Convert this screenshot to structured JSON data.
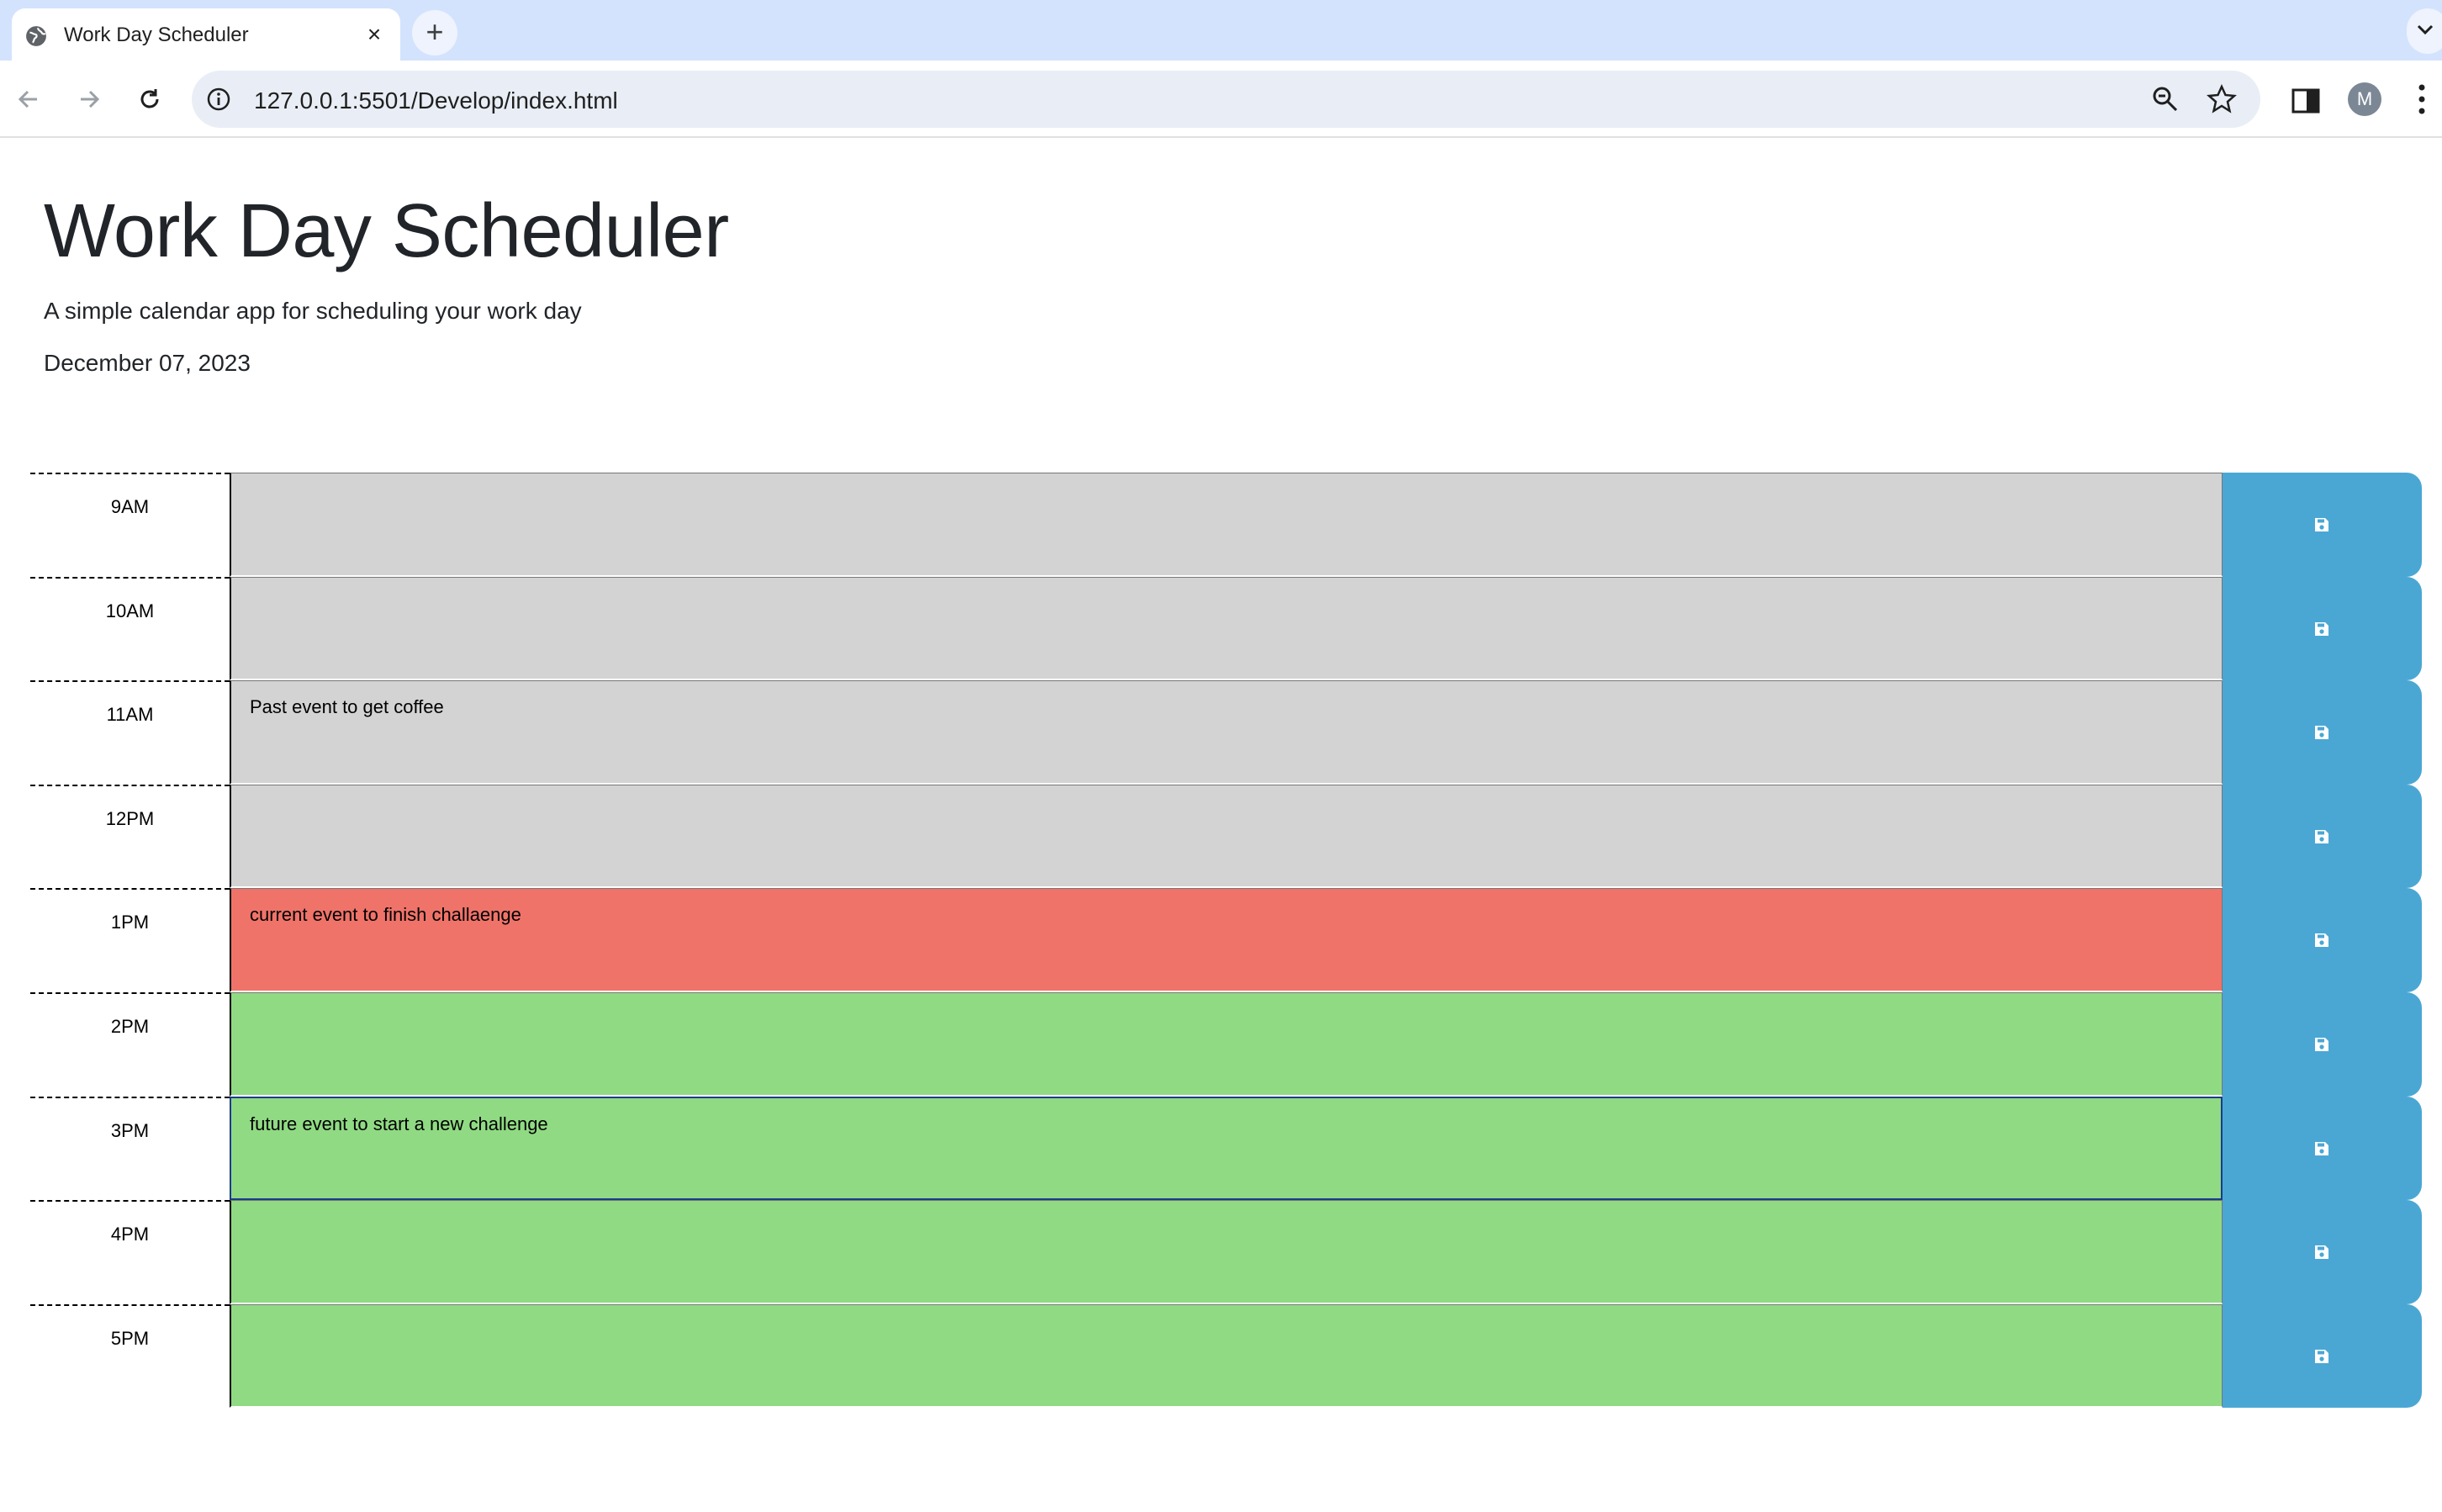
{
  "browser": {
    "tab_title": "Work Day Scheduler",
    "new_tab_symbol": "+",
    "close_symbol": "×",
    "url": "127.0.0.1:5501/Develop/index.html",
    "avatar_initial": "M"
  },
  "header": {
    "title": "Work Day Scheduler",
    "lead": "A simple calendar app for scheduling your work day",
    "current_day": "December 07, 2023"
  },
  "colors": {
    "past": "#d3d3d3",
    "present": "#ef7369",
    "future": "#90da83",
    "save_button": "#4aa7d4"
  },
  "schedule": {
    "rows": [
      {
        "hour": "9AM",
        "text": "",
        "state": "past"
      },
      {
        "hour": "10AM",
        "text": "",
        "state": "past"
      },
      {
        "hour": "11AM",
        "text": "Past event to get coffee",
        "state": "past"
      },
      {
        "hour": "12PM",
        "text": "",
        "state": "past"
      },
      {
        "hour": "1PM",
        "text": "current event to finish challaenge",
        "state": "present"
      },
      {
        "hour": "2PM",
        "text": "",
        "state": "future"
      },
      {
        "hour": "3PM",
        "text": "future event to start a new challenge",
        "state": "future"
      },
      {
        "hour": "4PM",
        "text": "",
        "state": "future"
      },
      {
        "hour": "5PM",
        "text": "",
        "state": "future"
      }
    ],
    "save_icon": "floppy-disk-icon"
  }
}
